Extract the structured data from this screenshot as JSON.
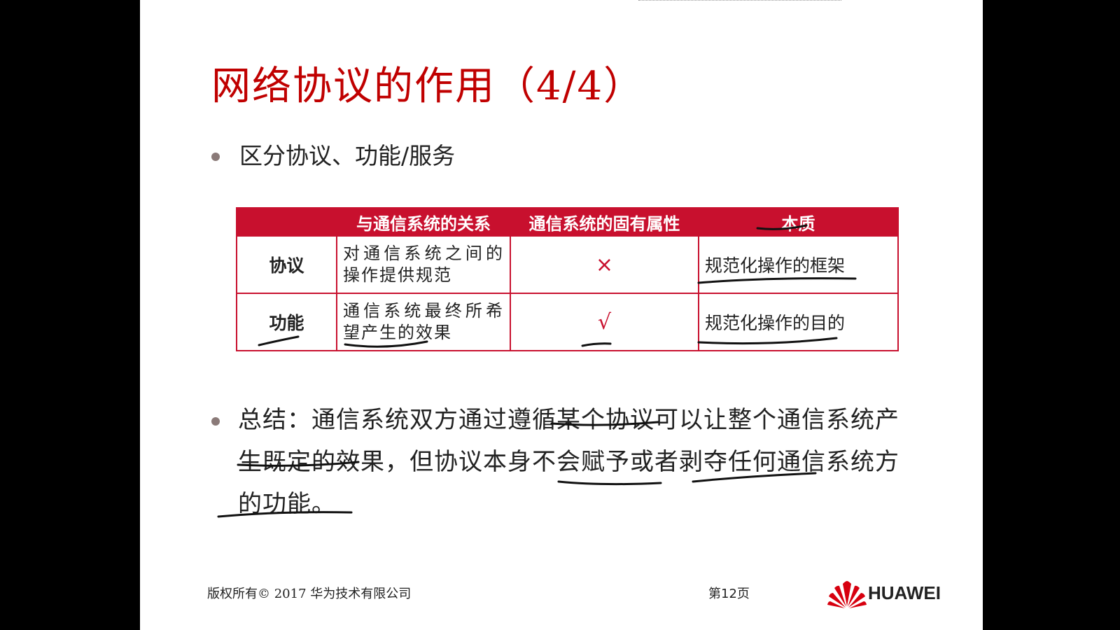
{
  "slide": {
    "title": "网络协议的作用（4/4）",
    "bullet1": "区分协议、功能/服务",
    "table": {
      "headers": [
        "",
        "与通信系统的关系",
        "通信系统的固有属性",
        "本质"
      ],
      "rows": [
        {
          "name": "协议",
          "relation": "对通信系统之间的操作提供规范",
          "inherent": "×",
          "essence": "规范化操作的框架"
        },
        {
          "name": "功能",
          "relation": "通信系统最终所希望产生的效果",
          "inherent": "√",
          "essence": "规范化操作的目的"
        }
      ]
    },
    "bullet2": "总结：通信系统双方通过遵循某个协议可以让整个通信系统产生既定的效果，但协议本身不会赋予或者剥夺任何通信系统方的功能。"
  },
  "footer": {
    "copyright": "版权所有© 2017 华为技术有限公司",
    "page": "第12页",
    "brand": "HUAWEI"
  },
  "colors": {
    "title_red": "#c00000",
    "table_red": "#c8102e",
    "background": "#000000",
    "slide": "#ffffff"
  }
}
